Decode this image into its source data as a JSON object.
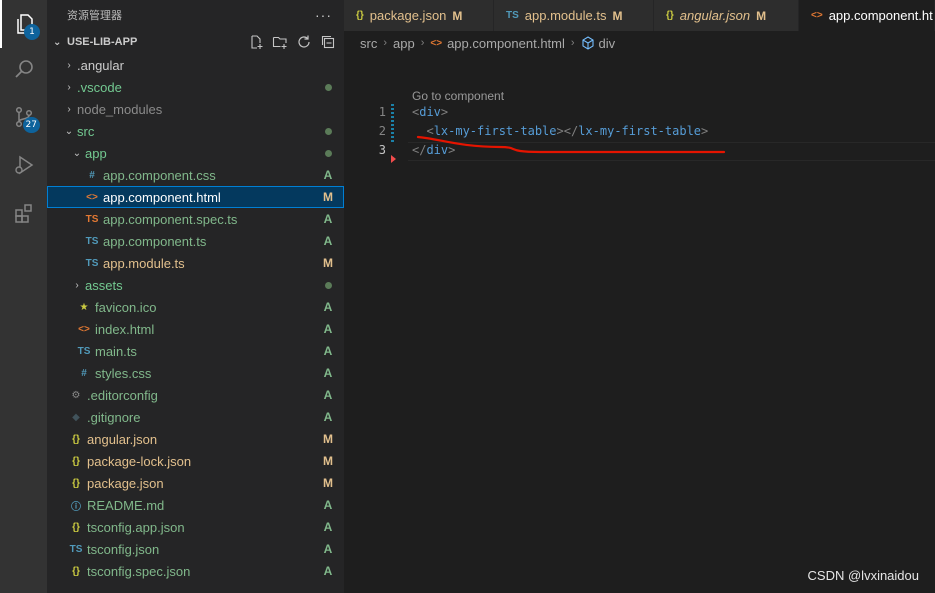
{
  "activity_bar": {
    "items": [
      {
        "icon": "files-icon",
        "badge": "1"
      },
      {
        "icon": "search-icon"
      },
      {
        "icon": "source-control-icon",
        "badge": "27"
      },
      {
        "icon": "run-debug-icon"
      },
      {
        "icon": "extensions-icon"
      }
    ]
  },
  "sidebar": {
    "title": "资源管理器",
    "more": "···",
    "project": "USE-LIB-APP",
    "tree": [
      {
        "label": ".angular",
        "indent": 1,
        "caret": "›",
        "icon": "",
        "status": "",
        "color": "norm"
      },
      {
        "label": ".vscode",
        "indent": 1,
        "caret": "›",
        "icon": "",
        "status": "dot",
        "color": "green"
      },
      {
        "label": "node_modules",
        "indent": 1,
        "caret": "›",
        "icon": "",
        "status": "",
        "color": "dim"
      },
      {
        "label": "src",
        "indent": 1,
        "caret": "⌄",
        "icon": "",
        "status": "dot",
        "color": "green"
      },
      {
        "label": "app",
        "indent": 2,
        "caret": "⌄",
        "icon": "",
        "status": "dot",
        "color": "green"
      },
      {
        "label": "app.component.css",
        "indent": 3,
        "caret": "",
        "icon": "#",
        "iconColor": "#519aba",
        "status": "A",
        "color": "add"
      },
      {
        "label": "app.component.html",
        "indent": 3,
        "caret": "",
        "icon": "<>",
        "iconColor": "#e37933",
        "status": "M",
        "color": "mod",
        "selected": true
      },
      {
        "label": "app.component.spec.ts",
        "indent": 3,
        "caret": "",
        "icon": "TS",
        "iconColor": "#e37933",
        "status": "A",
        "color": "add"
      },
      {
        "label": "app.component.ts",
        "indent": 3,
        "caret": "",
        "icon": "TS",
        "iconColor": "#519aba",
        "status": "A",
        "color": "add"
      },
      {
        "label": "app.module.ts",
        "indent": 3,
        "caret": "",
        "icon": "TS",
        "iconColor": "#519aba",
        "status": "M",
        "color": "mod"
      },
      {
        "label": "assets",
        "indent": 2,
        "caret": "›",
        "icon": "",
        "status": "dot",
        "color": "green"
      },
      {
        "label": "favicon.ico",
        "indent": 2,
        "caret": "",
        "icon": "★",
        "iconColor": "#cbcb41",
        "status": "A",
        "color": "add"
      },
      {
        "label": "index.html",
        "indent": 2,
        "caret": "",
        "icon": "<>",
        "iconColor": "#e37933",
        "status": "A",
        "color": "add"
      },
      {
        "label": "main.ts",
        "indent": 2,
        "caret": "",
        "icon": "TS",
        "iconColor": "#519aba",
        "status": "A",
        "color": "add"
      },
      {
        "label": "styles.css",
        "indent": 2,
        "caret": "",
        "icon": "#",
        "iconColor": "#519aba",
        "status": "A",
        "color": "add"
      },
      {
        "label": ".editorconfig",
        "indent": 1,
        "caret": "",
        "icon": "⚙",
        "iconColor": "#8a8a8a",
        "status": "A",
        "color": "add"
      },
      {
        "label": ".gitignore",
        "indent": 1,
        "caret": "",
        "icon": "◆",
        "iconColor": "#41535b",
        "status": "A",
        "color": "add"
      },
      {
        "label": "angular.json",
        "indent": 1,
        "caret": "",
        "icon": "{}",
        "iconColor": "#cbcb41",
        "status": "M",
        "color": "mod"
      },
      {
        "label": "package-lock.json",
        "indent": 1,
        "caret": "",
        "icon": "{}",
        "iconColor": "#cbcb41",
        "status": "M",
        "color": "mod"
      },
      {
        "label": "package.json",
        "indent": 1,
        "caret": "",
        "icon": "{}",
        "iconColor": "#cbcb41",
        "status": "M",
        "color": "mod"
      },
      {
        "label": "README.md",
        "indent": 1,
        "caret": "",
        "icon": "ⓘ",
        "iconColor": "#519aba",
        "status": "A",
        "color": "add"
      },
      {
        "label": "tsconfig.app.json",
        "indent": 1,
        "caret": "",
        "icon": "{}",
        "iconColor": "#cbcb41",
        "status": "A",
        "color": "add"
      },
      {
        "label": "tsconfig.json",
        "indent": 1,
        "caret": "",
        "icon": "TS",
        "iconColor": "#519aba",
        "status": "A",
        "color": "add"
      },
      {
        "label": "tsconfig.spec.json",
        "indent": 1,
        "caret": "",
        "icon": "{}",
        "iconColor": "#cbcb41",
        "status": "A",
        "color": "add"
      }
    ]
  },
  "tabs": [
    {
      "icon": "{}",
      "iconColor": "#cbcb41",
      "label": "package.json",
      "status": "M",
      "italic": false,
      "active": false
    },
    {
      "icon": "TS",
      "iconColor": "#519aba",
      "label": "app.module.ts",
      "status": "M",
      "italic": false,
      "active": false
    },
    {
      "icon": "{}",
      "iconColor": "#cbcb41",
      "label": "angular.json",
      "status": "M",
      "italic": true,
      "active": false
    },
    {
      "icon": "<>",
      "iconColor": "#e37933",
      "label": "app.component.ht",
      "status": "",
      "italic": false,
      "active": true
    }
  ],
  "breadcrumb": {
    "parts": [
      "src",
      "app",
      "app.component.html",
      "div"
    ]
  },
  "editor": {
    "codelens": "Go to component",
    "lines": [
      {
        "num": "1",
        "open": "<",
        "name": "div",
        "close": ">",
        "extra": ""
      },
      {
        "num": "2",
        "open": "  <",
        "name": "lx-my-first-table",
        "close": "></",
        "name2": "lx-my-first-table",
        "close2": ">"
      },
      {
        "num": "3",
        "open": "</",
        "name": "div",
        "close": ">",
        "extra": ""
      }
    ]
  },
  "watermark": "CSDN @lvxinaidou",
  "colors": {
    "modified": "#e2c08d",
    "added": "#81b88b",
    "selection": "#04395e",
    "annotation": "#e51400"
  }
}
